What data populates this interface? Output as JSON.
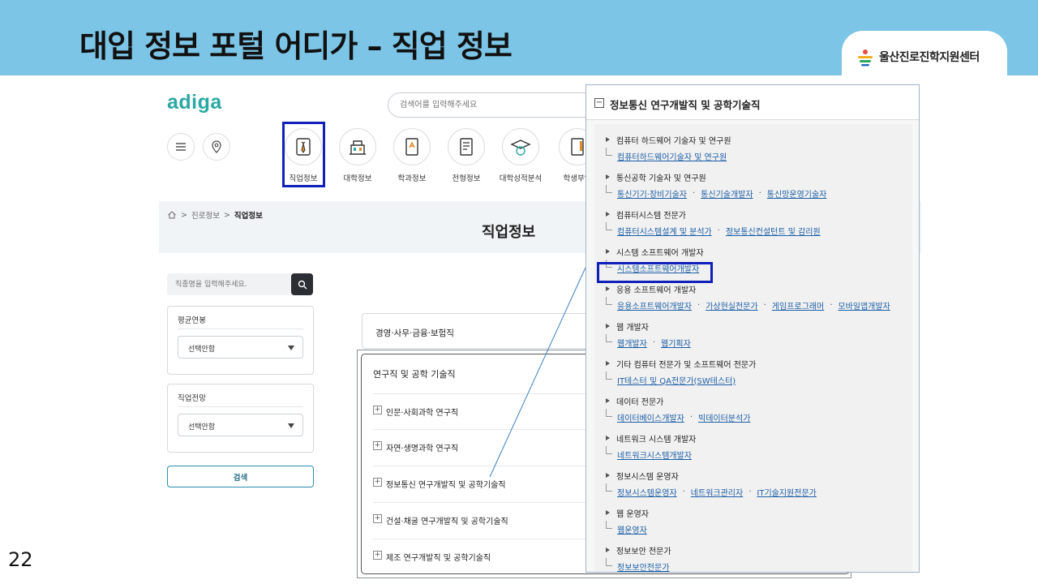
{
  "slide": {
    "title": "대입 정보 포털 어디가 – 직업 정보",
    "org_name": "울산진로진학지원센터",
    "page_number": "22"
  },
  "site": {
    "logo": "adiga",
    "search_placeholder": "검색어를 입력해주세요",
    "categories": [
      "직업정보",
      "대학정보",
      "학과정보",
      "전형정보",
      "대학성적분석",
      "학생부입"
    ],
    "breadcrumb": [
      "진로정보",
      "직업정보"
    ],
    "hero_title": "직업정보",
    "sidebar": {
      "search_placeholder": "직종명을 입력해주세요.",
      "filters": [
        {
          "title": "평균연봉",
          "value": "선택안함"
        },
        {
          "title": "직업전망",
          "value": "선택안함"
        }
      ],
      "apply_label": "검색"
    },
    "panel_first": "경영·사무·금융·보험직",
    "research": {
      "title": "연구직 및 공학 기술직",
      "items": [
        "인문·사회과학 연구직",
        "자연·생명과학 연구직",
        "정보통신 연구개발직 및 공학기술직",
        "건설·채굴 연구개발직 및 공학기술직",
        "제조 연구개발직 및 공학기술직"
      ]
    }
  },
  "popup": {
    "title": "정보통신 연구개발직 및 공학기술직",
    "groups": [
      {
        "title": "컴퓨터 하드웨어 기술자 및 연구원",
        "links": [
          "컴퓨터하드웨어기술자 및 연구원"
        ]
      },
      {
        "title": "통신공학 기술자 및 연구원",
        "links": [
          "통신기기·장비기술자",
          "통신기술개발자",
          "통신망운영기술자"
        ]
      },
      {
        "title": "컴퓨터시스템 전문가",
        "links": [
          "컴퓨터시스템설계 및 분석가",
          "정보통신컨설턴트 및 감리원"
        ]
      },
      {
        "title": "시스템 소프트웨어 개발자",
        "links": [
          "시스템소프트웨어개발자"
        ]
      },
      {
        "title": "응용 소프트웨어 개발자",
        "links": [
          "응용소프트웨어개발자",
          "가상현실전문가",
          "게임프로그래머",
          "모바일앱개발자"
        ]
      },
      {
        "title": "웹 개발자",
        "links": [
          "웹개발자",
          "웹기획자"
        ]
      },
      {
        "title": "기타 컴퓨터 전문가 및 소프트웨어 전문가",
        "links": [
          "IT테스터 및 QA전문가(SW테스터)"
        ]
      },
      {
        "title": "데이터 전문가",
        "links": [
          "데이터베이스개발자",
          "빅데이터분석가"
        ]
      },
      {
        "title": "네트워크 시스템 개발자",
        "links": [
          "네트워크시스템개발자"
        ]
      },
      {
        "title": "정보시스템 운영자",
        "links": [
          "정보시스템운영자",
          "네트워크관리자",
          "IT기술지원전문가"
        ]
      },
      {
        "title": "웹 운영자",
        "links": [
          "웹운영자"
        ]
      },
      {
        "title": "정보보안 전문가",
        "links": [
          "정보보안전문가"
        ]
      }
    ]
  },
  "colors": {
    "header_bg": "#7cc5e6",
    "brand_teal": "#2aa8a3",
    "highlight_blue": "#1020b8",
    "link_blue": "#1d5fa6"
  }
}
